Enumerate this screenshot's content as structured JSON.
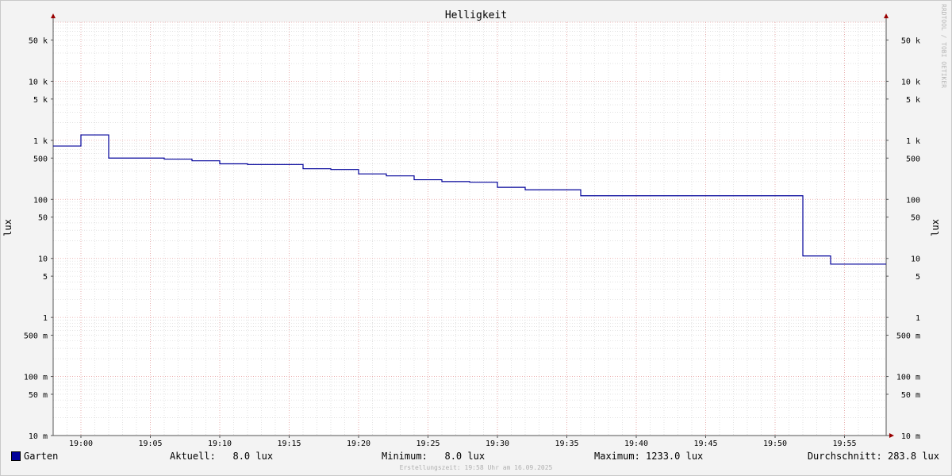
{
  "chart_data": {
    "type": "line",
    "title": "Helligkeit",
    "ylabel": "lux",
    "y_scale": "log",
    "ylim": [
      0.01,
      100000
    ],
    "xlim": [
      "18:58",
      "19:58"
    ],
    "x_ticks": [
      "19:00",
      "19:05",
      "19:10",
      "19:15",
      "19:20",
      "19:25",
      "19:30",
      "19:35",
      "19:40",
      "19:45",
      "19:50",
      "19:55"
    ],
    "y_ticks": [
      {
        "value": 50000,
        "label": "50 k"
      },
      {
        "value": 10000,
        "label": "10 k"
      },
      {
        "value": 5000,
        "label": "5 k"
      },
      {
        "value": 1000,
        "label": "1 k"
      },
      {
        "value": 500,
        "label": "500"
      },
      {
        "value": 100,
        "label": "100"
      },
      {
        "value": 50,
        "label": "50"
      },
      {
        "value": 10,
        "label": "10"
      },
      {
        "value": 5,
        "label": "5"
      },
      {
        "value": 1,
        "label": "1"
      },
      {
        "value": 0.5,
        "label": "500 m"
      },
      {
        "value": 0.1,
        "label": "100 m"
      },
      {
        "value": 0.05,
        "label": "50 m"
      },
      {
        "value": 0.01,
        "label": "10 m"
      }
    ],
    "grid": true,
    "series": [
      {
        "name": "Garten",
        "color": "#000099",
        "step": true,
        "points": [
          {
            "x": "18:58",
            "y": 800
          },
          {
            "x": "19:00",
            "y": 1233
          },
          {
            "x": "19:02",
            "y": 500
          },
          {
            "x": "19:06",
            "y": 480
          },
          {
            "x": "19:08",
            "y": 450
          },
          {
            "x": "19:10",
            "y": 400
          },
          {
            "x": "19:12",
            "y": 390
          },
          {
            "x": "19:16",
            "y": 330
          },
          {
            "x": "19:18",
            "y": 320
          },
          {
            "x": "19:20",
            "y": 270
          },
          {
            "x": "19:22",
            "y": 250
          },
          {
            "x": "19:24",
            "y": 215
          },
          {
            "x": "19:26",
            "y": 200
          },
          {
            "x": "19:28",
            "y": 195
          },
          {
            "x": "19:30",
            "y": 160
          },
          {
            "x": "19:32",
            "y": 145
          },
          {
            "x": "19:36",
            "y": 115
          },
          {
            "x": "19:52",
            "y": 11
          },
          {
            "x": "19:54",
            "y": 8
          },
          {
            "x": "19:58",
            "y": 8
          }
        ]
      }
    ]
  },
  "legend": {
    "series_name": "Garten",
    "series_color": "#000099",
    "current": "Aktuell:   8.0 lux",
    "minimum": "Minimum:   8.0 lux",
    "maximum": "Maximum: 1233.0 lux",
    "average": "Durchschnitt: 283.8 lux"
  },
  "watermark": "RRDTOOL / TOBI OETIKER",
  "footer": "Erstellungszeit: 19:58 Uhr am 16.09.2025",
  "colors": {
    "minor_grid": "#d0d0d0",
    "major_grid": "#e8a0a0",
    "axis": "#555555",
    "arrow": "#990000"
  }
}
